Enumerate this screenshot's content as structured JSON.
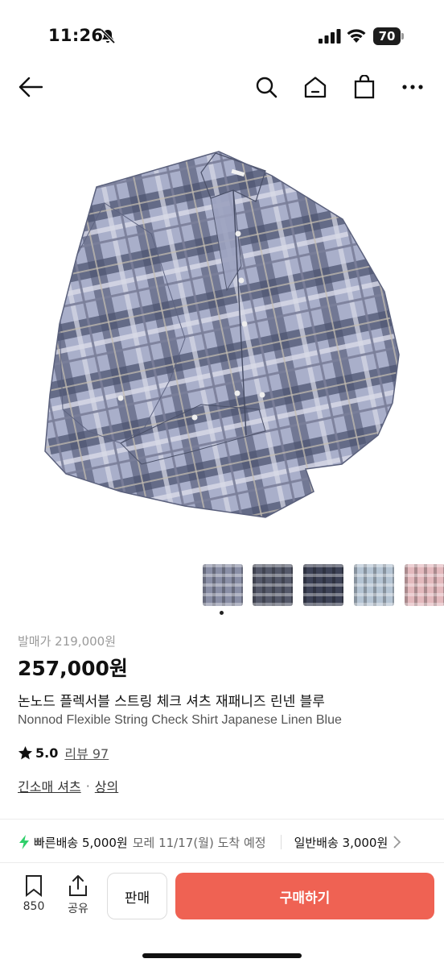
{
  "status_bar": {
    "time": "11:26",
    "battery": "70"
  },
  "product": {
    "original_price": "발매가 219,000원",
    "price": "257,000원",
    "title_kr": "논노드 플렉서블 스트링 체크 셔츠 재패니즈 린넨 블루",
    "title_en": "Nonnod Flexible String Check Shirt Japanese Linen Blue",
    "rating": "5.0",
    "review_text": "리뷰 97",
    "categories": [
      "긴소매 셔츠",
      "상의"
    ],
    "category_separator": "·",
    "thumbnail_colors": [
      "#8a8fa6",
      "#55596a",
      "#3d4256",
      "#b5c4d3",
      "#e3b9bd"
    ]
  },
  "shipping": {
    "fast_label": "빠른배송 5,000원",
    "fast_eta": "모레 11/17(월) 도착 예정",
    "normal_label": "일반배송 3,000원"
  },
  "bottom_bar": {
    "save_count": "850",
    "share_label": "공유",
    "sell_label": "판매",
    "buy_label": "구매하기"
  },
  "colors": {
    "accent": "#ef6253",
    "fast_shipping_green": "#2fcf6a",
    "shirt_base": "#9aa0bd"
  }
}
